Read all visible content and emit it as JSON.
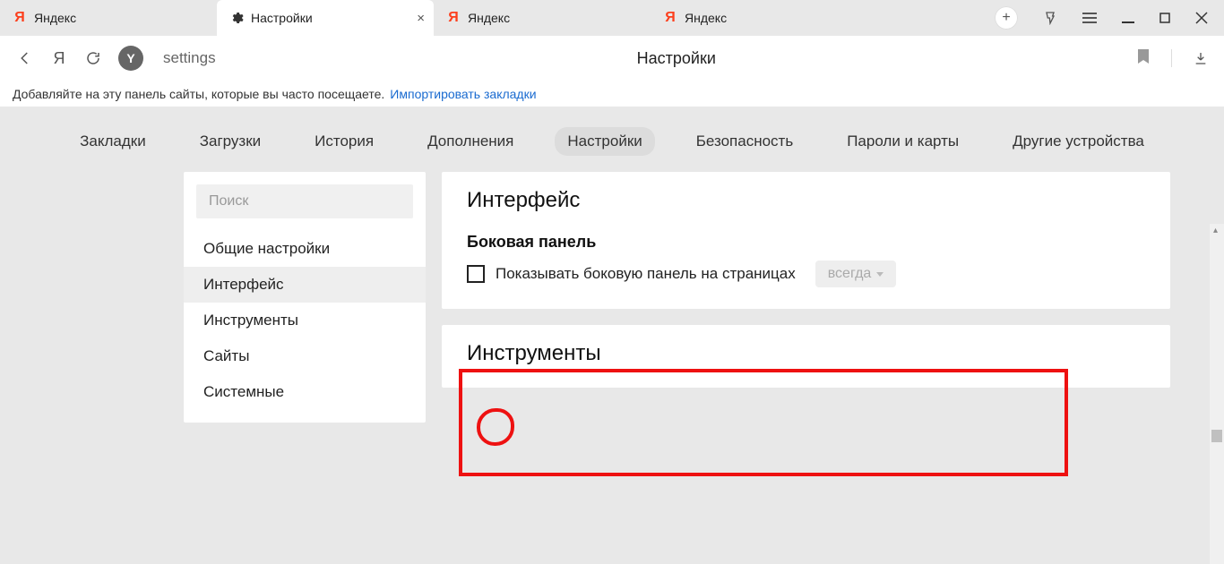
{
  "tabs": [
    {
      "title": "Яндекс",
      "icon": "ya",
      "active": false
    },
    {
      "title": "Настройки",
      "icon": "gear",
      "active": true
    },
    {
      "title": "Яндекс",
      "icon": "ya",
      "active": false
    },
    {
      "title": "Яндекс",
      "icon": "ya",
      "active": false
    }
  ],
  "toolbar": {
    "address": "settings",
    "page_title": "Настройки"
  },
  "bookmark_bar": {
    "message": "Добавляйте на эту панель сайты, которые вы часто посещаете.",
    "import_link": "Импортировать закладки"
  },
  "topnav": {
    "items": [
      "Закладки",
      "Загрузки",
      "История",
      "Дополнения",
      "Настройки",
      "Безопасность",
      "Пароли и карты",
      "Другие устройства"
    ],
    "active_index": 4
  },
  "sidebar": {
    "search_placeholder": "Поиск",
    "items": [
      "Общие настройки",
      "Интерфейс",
      "Инструменты",
      "Сайты",
      "Системные"
    ],
    "active_index": 1
  },
  "main": {
    "interface": {
      "heading": "Интерфейс",
      "side_panel": {
        "title": "Боковая панель",
        "checkbox_label": "Показывать боковую панель на страницах",
        "dropdown_value": "всегда",
        "checkbox_checked": false
      }
    },
    "tools": {
      "heading": "Инструменты"
    }
  }
}
